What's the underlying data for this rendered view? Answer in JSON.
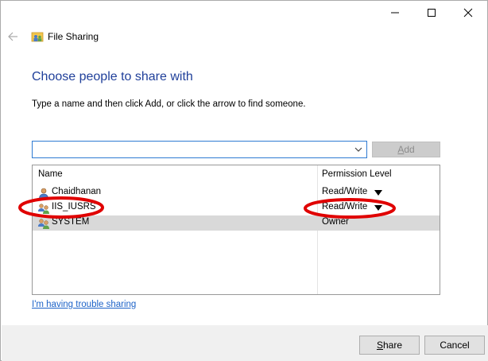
{
  "window": {
    "title": "File Sharing",
    "controls": [
      "minimize-icon",
      "maximize-icon",
      "close-icon"
    ]
  },
  "content": {
    "heading": "Choose people to share with",
    "instruction": "Type a name and then click Add, or click the arrow to find someone.",
    "name_input": {
      "value": "",
      "placeholder": ""
    },
    "add_button": {
      "label_pre": "",
      "label_u": "A",
      "label_post": "dd",
      "enabled": false
    }
  },
  "list": {
    "headers": {
      "name": "Name",
      "permission": "Permission Level"
    },
    "rows": [
      {
        "name": "Chaidhanan",
        "permission": "Read/Write",
        "has_dropdown": true,
        "icon": "user-icon",
        "selected": false
      },
      {
        "name": "IIS_IUSRS",
        "permission": "Read/Write",
        "has_dropdown": true,
        "icon": "group-icon",
        "selected": false,
        "highlighted": true
      },
      {
        "name": "SYSTEM",
        "permission": "Owner",
        "has_dropdown": false,
        "icon": "group-icon",
        "selected": true
      }
    ]
  },
  "trouble_link": "I'm having trouble sharing",
  "footer": {
    "share": {
      "pre": "",
      "u": "S",
      "post": "hare"
    },
    "cancel": "Cancel"
  },
  "colors": {
    "heading": "#1f3f9a",
    "link": "#1d63c8",
    "annotation": "#e00000",
    "selection": "#d9d9d9",
    "input_border": "#2f7bd2"
  }
}
